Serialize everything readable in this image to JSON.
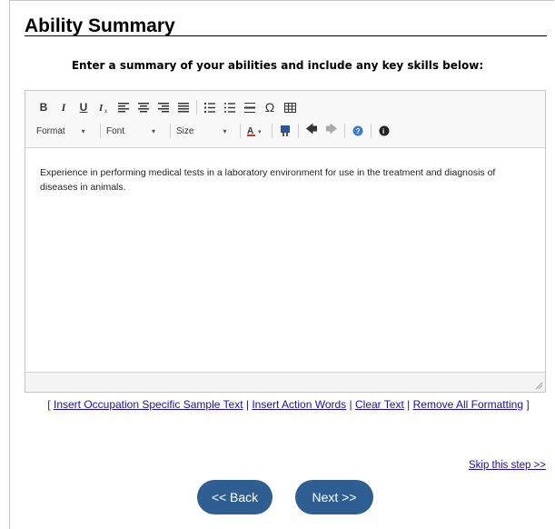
{
  "page": {
    "title": "Ability Summary",
    "instruction": "Enter a summary of your abilities and include any key skills below:"
  },
  "editor": {
    "toolbar": {
      "format_label": "Format",
      "font_label": "Font",
      "size_label": "Size"
    },
    "content": "Experience in performing medical tests in a laboratory environment for use in the treatment and diagnosis of diseases in animals."
  },
  "links": {
    "open_bracket": "[",
    "insert_sample": "Insert Occupation Specific Sample Text",
    "insert_action": "Insert Action Words",
    "clear_text": "Clear Text",
    "remove_formatting": "Remove All Formatting",
    "close_bracket": "]",
    "separator": "|"
  },
  "skip_label": "Skip this step >>",
  "buttons": {
    "back": "<< Back",
    "next": "Next >>"
  },
  "colors": {
    "button_bg": "#2f5f92",
    "link": "#1a0dab"
  }
}
